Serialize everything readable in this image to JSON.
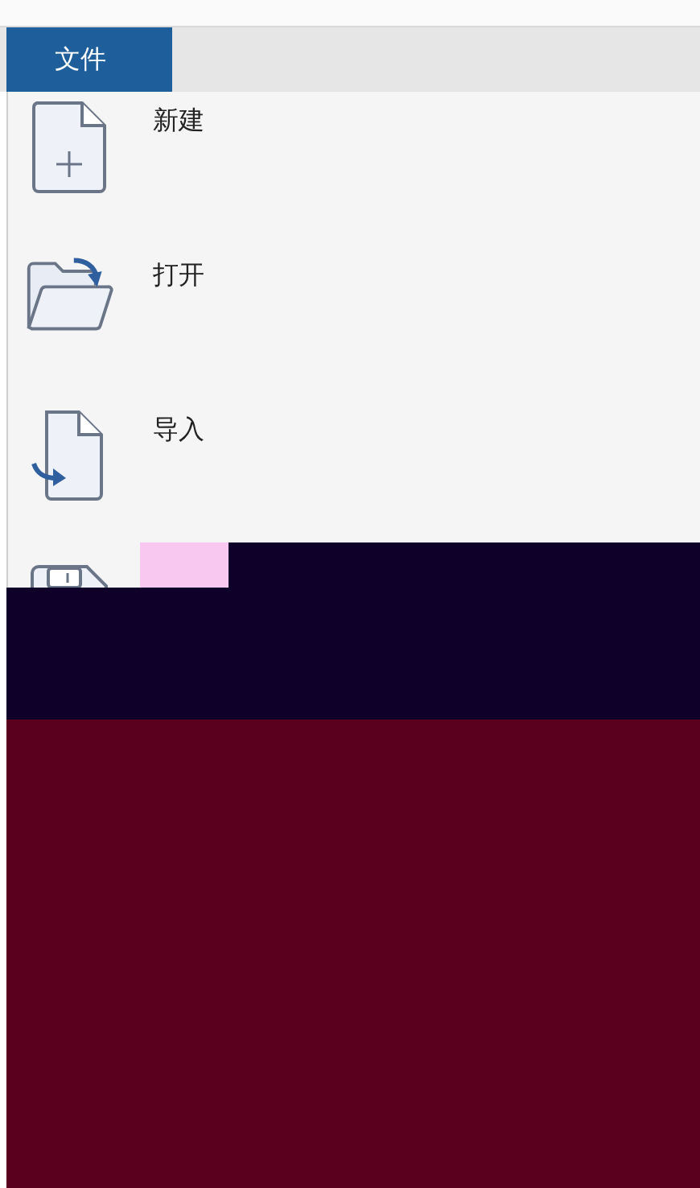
{
  "tabs": [
    {
      "label": "文件",
      "selected": true
    }
  ],
  "menu": {
    "items": [
      {
        "kind": "new",
        "label": "新建"
      },
      {
        "kind": "open",
        "label": "打开"
      },
      {
        "kind": "import",
        "label": "导入"
      },
      {
        "kind": "save"
      }
    ]
  }
}
